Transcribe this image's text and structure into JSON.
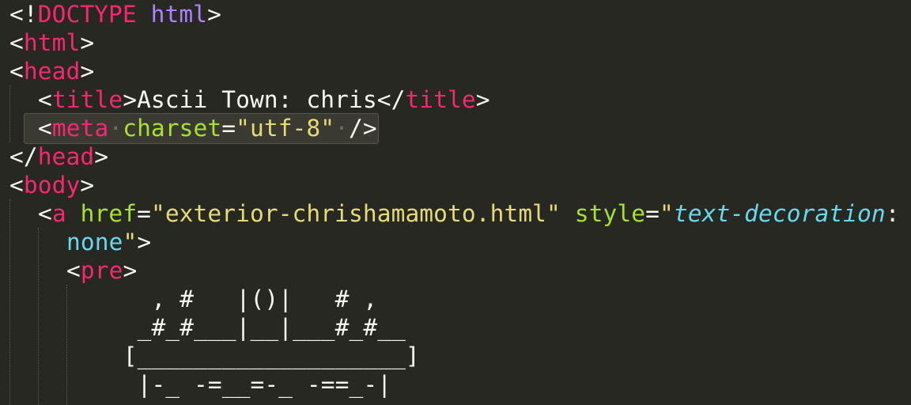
{
  "editor": {
    "lines": [
      {
        "id": "l1",
        "parts": [
          "<!",
          "DOCTYPE",
          " ",
          "html",
          ">"
        ]
      },
      {
        "id": "l2",
        "parts": [
          "<",
          "html",
          ">"
        ]
      },
      {
        "id": "l3",
        "parts": [
          "<",
          "head",
          ">"
        ]
      },
      {
        "id": "l4",
        "parts": [
          "<",
          "title",
          ">",
          "Ascii Town: chris",
          "</",
          "title",
          ">"
        ]
      },
      {
        "id": "l5",
        "parts": [
          "<",
          "meta",
          "·",
          "charset",
          "=",
          "\"utf-8\"",
          "·",
          "/>"
        ]
      },
      {
        "id": "l6",
        "parts": [
          "</",
          "head",
          ">"
        ]
      },
      {
        "id": "l7",
        "parts": [
          "<",
          "body",
          ">"
        ]
      },
      {
        "id": "l8",
        "parts": [
          "<",
          "a",
          " ",
          "href",
          "=",
          "\"exterior-chrishamamoto.html\"",
          " ",
          "style",
          "=",
          "\"",
          "text-decoration",
          ":"
        ]
      },
      {
        "id": "l9",
        "parts": [
          "none",
          "\"",
          ">"
        ]
      },
      {
        "id": "l10",
        "parts": [
          "<",
          "pre",
          ">"
        ]
      },
      {
        "id": "l11",
        "parts": [
          "    , #   |()|   # ,"
        ]
      },
      {
        "id": "l12",
        "parts": [
          "   _#_#___|__|___#_#__"
        ]
      },
      {
        "id": "l13",
        "parts": [
          "  [___________________]"
        ]
      },
      {
        "id": "l14",
        "parts": [
          "   |-_ -=__=-_ -==_-|"
        ]
      }
    ]
  },
  "colors": {
    "background": "#272822",
    "tag": "#f92672",
    "doctype_name": "#ae81ff",
    "attribute": "#a6e22e",
    "string": "#e6db74",
    "css": "#66d9ef",
    "text": "#f8f8f2"
  }
}
